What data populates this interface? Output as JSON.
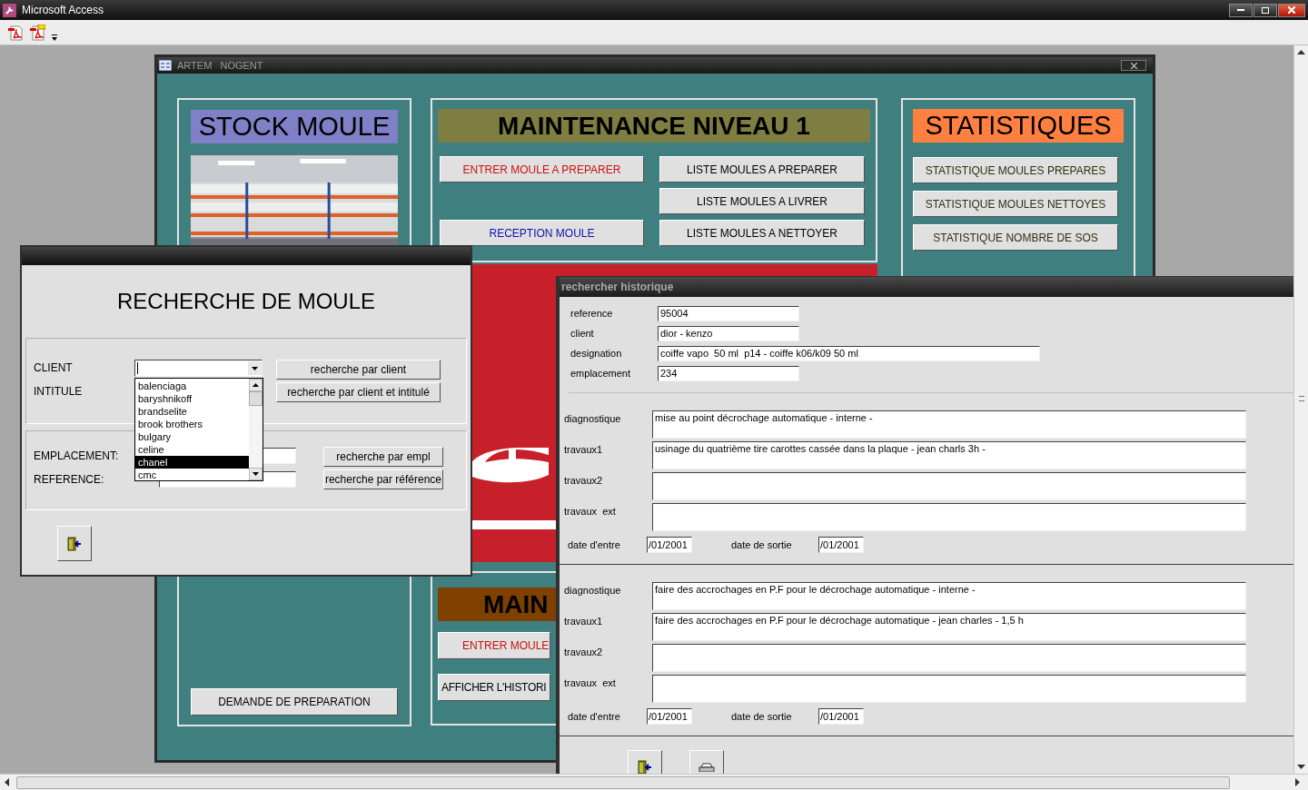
{
  "app": {
    "title": "Microsoft Access"
  },
  "main_form": {
    "title": "ARTEM   NOGENT",
    "stock": {
      "title": "STOCK MOULE",
      "button": "DEMANDE DE PREPARATION"
    },
    "maintenance": {
      "title": "MAINTENANCE NIVEAU 1",
      "left_buttons": [
        {
          "label": "ENTRER MOULE A PREPARER",
          "color": "#cc1010"
        },
        {
          "label": "RECEPTION MOULE",
          "color": "#1010b0"
        }
      ],
      "right_buttons": [
        {
          "label": "LISTE MOULES A PREPARER",
          "color": "#000000"
        },
        {
          "label": "LISTE MOULES A LIVRER",
          "color": "#000000"
        },
        {
          "label": "LISTE MOULES A NETTOYER",
          "color": "#000000"
        }
      ]
    },
    "statistics": {
      "title": "STATISTIQUES",
      "buttons": [
        "STATISTIQUE MOULES PREPARES",
        "STATISTIQUE MOULES NETTOYES",
        "STATISTIQUE NOMBRE DE SOS"
      ]
    },
    "maintenance_2": {
      "title": "MAIN",
      "buttons": [
        {
          "label": "ENTRER MOULE",
          "color": "#cc1010"
        },
        {
          "label": "AFFICHER L'HISTORI",
          "color": "#000000"
        }
      ]
    }
  },
  "search_dialog": {
    "title": "RECHERCHE DE MOULE",
    "client_label": "CLIENT",
    "intitule_label": "INTITULE",
    "client_options": [
      {
        "label": "balenciaga",
        "selected": false
      },
      {
        "label": "baryshnikoff",
        "selected": false
      },
      {
        "label": "brandselite",
        "selected": false
      },
      {
        "label": "brook brothers",
        "selected": false
      },
      {
        "label": "bulgary",
        "selected": false
      },
      {
        "label": "celine",
        "selected": false
      },
      {
        "label": "chanel",
        "selected": true
      },
      {
        "label": "cmc",
        "selected": false
      }
    ],
    "client_buttons": [
      "recherche par client",
      "recherche par client et intitulé"
    ],
    "location_label": "EMPLACEMENT:",
    "reference_label": "REFERENCE:",
    "location_buttons": [
      "recherche par empl",
      "recherche par référence"
    ]
  },
  "history_window": {
    "title": "rechercher historique",
    "fields": [
      {
        "label": "reference",
        "value": "95004"
      },
      {
        "label": "client",
        "value": "dior - kenzo"
      },
      {
        "label": "designation",
        "value": "coiffe vapo  50 ml  p14 - coiffe k06/k09 50 ml",
        "kind": "wide"
      },
      {
        "label": "emplacement",
        "value": "234"
      }
    ],
    "records": [
      {
        "fields": [
          {
            "label": "diagnostique",
            "value": "mise au point décrochage automatique - interne -"
          },
          {
            "label": "travaux1",
            "value": "usinage du quatrième tire carottes cassée dans la plaque - jean charls 3h -"
          },
          {
            "label": "travaux2"
          },
          {
            "label": "travaux  ext"
          }
        ],
        "dates": [
          {
            "label": "date d'entre",
            "value": "/01/2001"
          },
          {
            "label": "date de sortie",
            "value": "/01/2001"
          }
        ]
      },
      {
        "fields": [
          {
            "label": "diagnostique",
            "value": "faire des accrochages en P.F pour le décrochage automatique - interne -"
          },
          {
            "label": "travaux1",
            "value": "faire des accrochages en P.F pour le décrochage automatique - jean charles - 1,5 h"
          },
          {
            "label": "travaux2"
          },
          {
            "label": "travaux  ext"
          }
        ],
        "dates": [
          {
            "label": "date d'entre",
            "value": "/01/2001"
          },
          {
            "label": "date de sortie",
            "value": "/01/2001"
          }
        ]
      }
    ]
  }
}
